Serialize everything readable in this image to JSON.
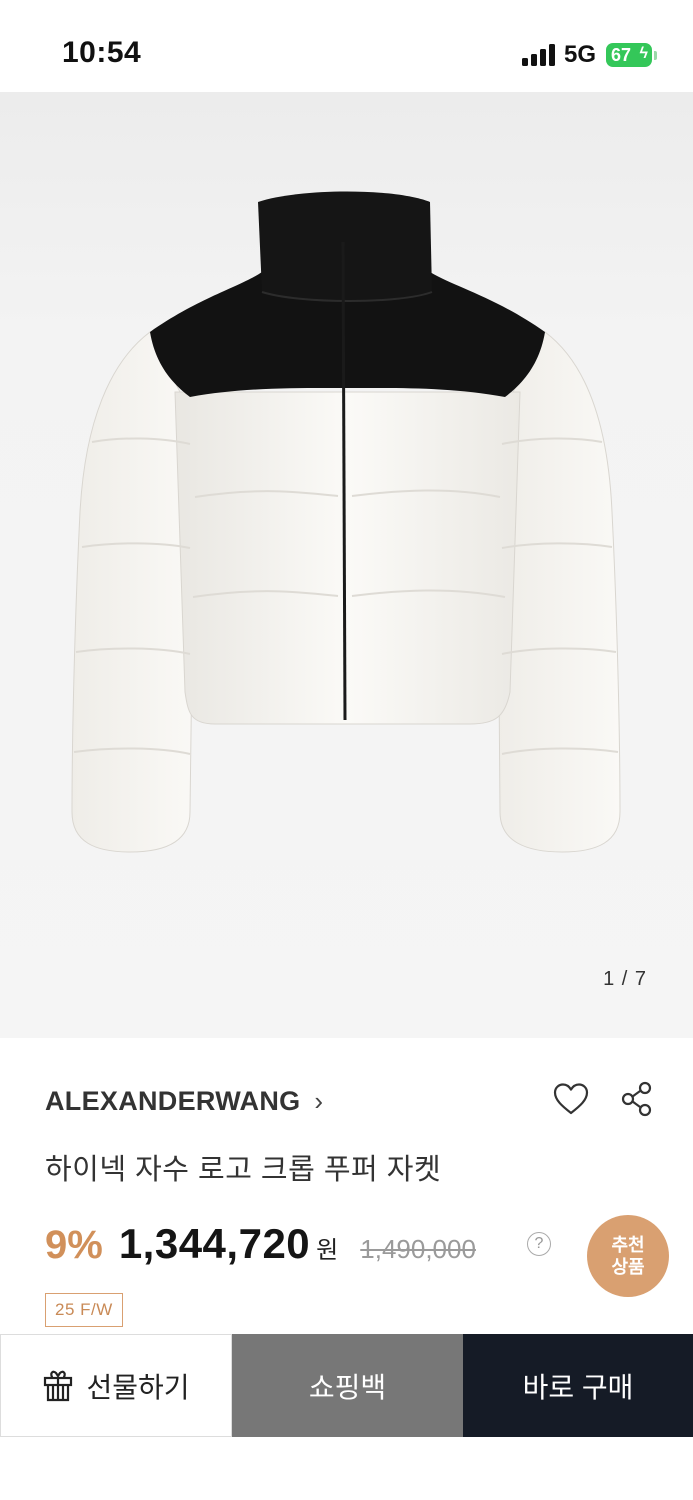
{
  "status_bar": {
    "time": "10:54",
    "network": "5G",
    "battery": "67",
    "icons": [
      "signal-icon",
      "battery-icon"
    ]
  },
  "gallery": {
    "counter": "1 / 7",
    "image_alt": "jacket-photo"
  },
  "product": {
    "brand": "ALEXANDERWANG",
    "brand_chevron": "›",
    "title": "하이넥 자수 로고 크롭 푸퍼 자켓",
    "discount": "9%",
    "price": "1,344,720",
    "currency": "원",
    "original_price": "1,490,000",
    "help": "?",
    "season_tag": "25 F/W",
    "recommend_line1": "추천",
    "recommend_line2": "상품",
    "icons": [
      "heart-icon",
      "share-icon"
    ]
  },
  "actions": {
    "gift_label": "선물하기",
    "bag_label": "쇼핑백",
    "buy_label": "바로 구매",
    "gift_icon": "gift-icon"
  },
  "colors": {
    "accent": "#d1905a",
    "badge": "#d9a071",
    "buy_button": "#151b26",
    "bag_button": "#777777",
    "battery": "#34c759"
  }
}
